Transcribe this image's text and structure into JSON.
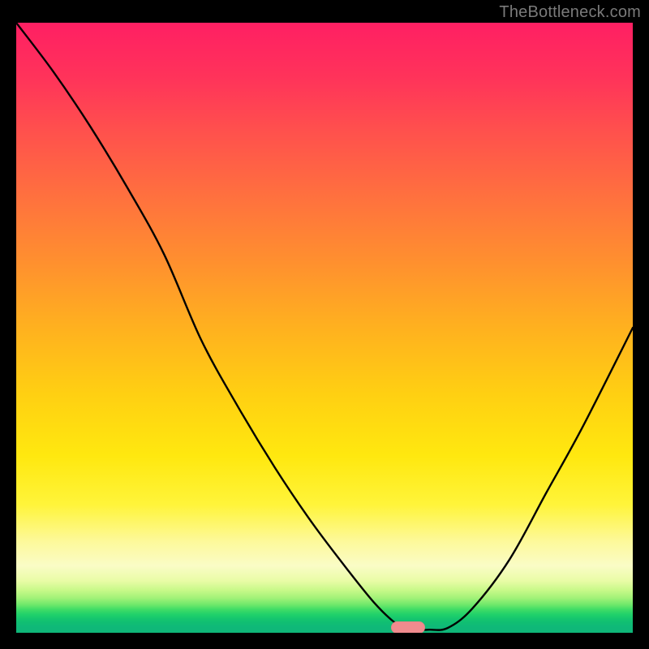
{
  "watermark": "TheBottleneck.com",
  "marker": {
    "color": "#f08b8e",
    "x_frac": 0.635,
    "y_frac": 0.992
  },
  "chart_data": {
    "type": "line",
    "title": "",
    "xlabel": "",
    "ylabel": "",
    "xlim": [
      0,
      100
    ],
    "ylim": [
      0,
      100
    ],
    "grid": false,
    "legend": false,
    "background": "vertical-gradient red→orange→yellow→green",
    "series": [
      {
        "name": "bottleneck-curve",
        "color": "#000000",
        "x": [
          0,
          6,
          12,
          18,
          24,
          30,
          36,
          42,
          48,
          54,
          58,
          61,
          63,
          65,
          67,
          70,
          74,
          80,
          86,
          92,
          100
        ],
        "y": [
          100,
          92,
          83,
          73,
          62,
          48,
          37,
          27,
          18,
          10,
          5,
          2,
          0.8,
          0.5,
          0.5,
          0.8,
          4,
          12,
          23,
          34,
          50
        ]
      }
    ],
    "annotations": [
      {
        "type": "pill-marker",
        "x": 63.5,
        "y": 0.8,
        "color": "#f08b8e"
      }
    ]
  }
}
